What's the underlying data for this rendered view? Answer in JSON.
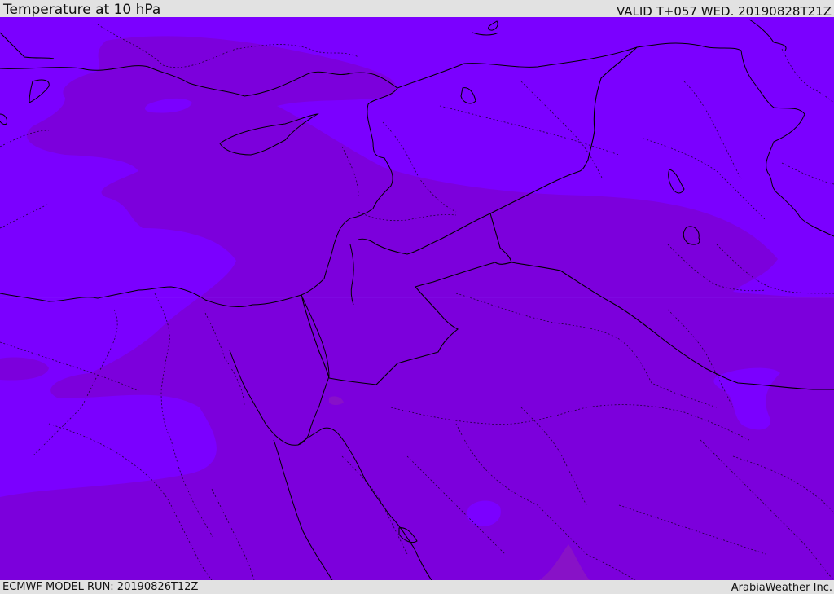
{
  "header": {
    "title": "Temperature at 10 hPa",
    "valid": "VALID T+057 WED. 20190828T21Z"
  },
  "footer": {
    "model_run": "ECMWF MODEL RUN: 20190826T12Z",
    "credit": "ArabiaWeather Inc."
  },
  "colors": {
    "background_fill": "#7b00ff",
    "warmer_band": "#7c00dc",
    "warmest_spot": "#8a14c4",
    "boundary_line": "#000000"
  }
}
